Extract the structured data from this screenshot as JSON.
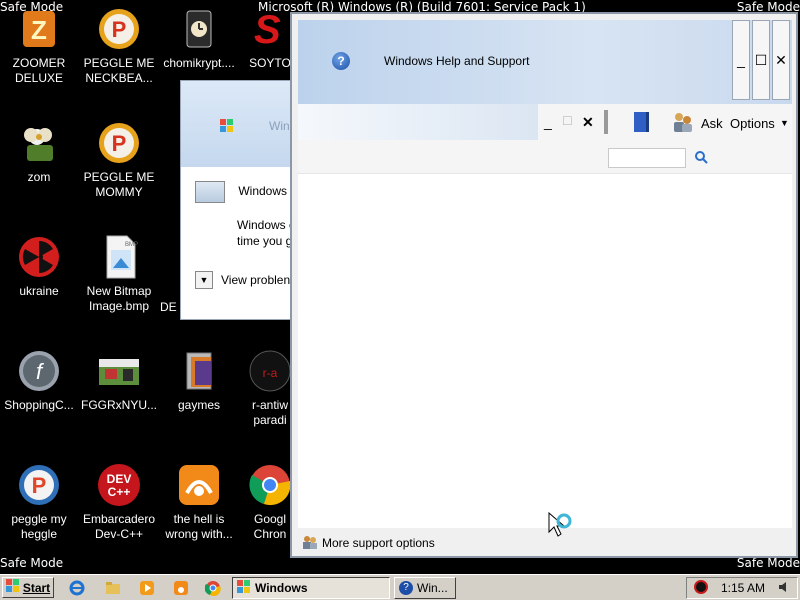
{
  "desktop": {
    "safe_mode_label": "Safe Mode",
    "build_text": "Microsoft (R) Windows (R) (Build 7601: Service Pack 1)",
    "icons": [
      {
        "label": "ZOOMER DELUXE",
        "icon": "zoomer-icon"
      },
      {
        "label": "PEGGLE ME NECKBEA...",
        "icon": "peggle-icon"
      },
      {
        "label": "chomikrypt....",
        "icon": "chomikrypt-icon"
      },
      {
        "label": "SOYTO",
        "icon": "soyto-icon"
      },
      {
        "label": "zom",
        "icon": "zom-icon"
      },
      {
        "label": "PEGGLE ME MOMMY",
        "icon": "peggle-icon"
      },
      {
        "label": "ukraine",
        "icon": "radiation-icon"
      },
      {
        "label": "New Bitmap Image.bmp",
        "icon": "bitmap-file-icon"
      },
      {
        "label": "DE",
        "icon": "partial-icon"
      },
      {
        "label": "ShoppingC...",
        "icon": "flash-icon"
      },
      {
        "label": "FGGRxNYU...",
        "icon": "image-file-icon"
      },
      {
        "label": "gaymes",
        "icon": "folder-icon"
      },
      {
        "label": "r-antiw paradi",
        "icon": "r-antiw-icon"
      },
      {
        "label": "peggle my heggle",
        "icon": "peggle-icon"
      },
      {
        "label": "Embarcadero Dev-C++",
        "icon": "devcpp-icon"
      },
      {
        "label": "the hell is wrong with...",
        "icon": "uc-browser-icon"
      },
      {
        "label": "Googl Chron",
        "icon": "chrome-icon"
      }
    ]
  },
  "behind_window": {
    "title": "Windows",
    "row1_text": "Windows I",
    "row2_line1": "Windows c",
    "row2_line2": "time you g",
    "view_problems": "View problen"
  },
  "help_window": {
    "title": "Windows Help and Support",
    "min_label": "_",
    "max_label": "☐",
    "close_label": "✕",
    "ask_label": "Ask",
    "options_label": "Options",
    "search_placeholder": "",
    "footer_label": "More support options"
  },
  "taskbar": {
    "start_label": "Start",
    "tasks": [
      {
        "label": "Windows",
        "active": true
      },
      {
        "label": "Win..."
      }
    ],
    "time": "1:15 AM"
  }
}
